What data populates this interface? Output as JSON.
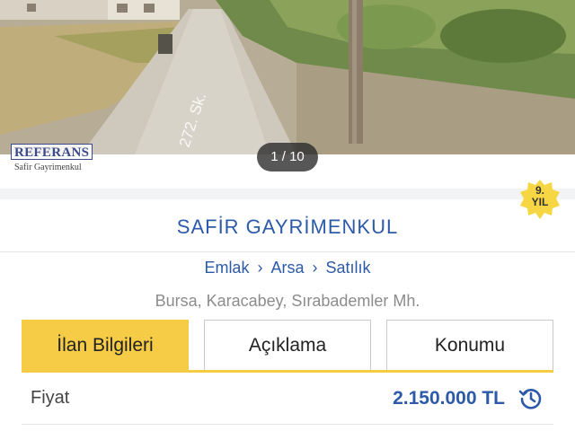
{
  "gallery": {
    "counter": "1 / 10",
    "street_sign": "272. Sk.",
    "watermark": {
      "brand": "REFERANS",
      "caption": "Safir Gayrimenkul"
    }
  },
  "badge": {
    "line1": "9.",
    "line2": "YIL",
    "color": "#f6d743"
  },
  "listing": {
    "seller": "SAFİR GAYRİMENKUL",
    "breadcrumb": [
      "Emlak",
      "Arsa",
      "Satılık"
    ],
    "breadcrumb_separator": "›",
    "location": "Bursa, Karacabey, Sırabademler Mh."
  },
  "tabs": [
    {
      "label": "İlan Bilgileri",
      "active": true
    },
    {
      "label": "Açıklama",
      "active": false
    },
    {
      "label": "Konumu",
      "active": false
    }
  ],
  "details": {
    "price_label": "Fiyat",
    "price_value": "2.150.000 TL",
    "history_icon": "history-icon"
  },
  "colors": {
    "accent": "#f6cb45",
    "link": "#2d5aa8"
  }
}
